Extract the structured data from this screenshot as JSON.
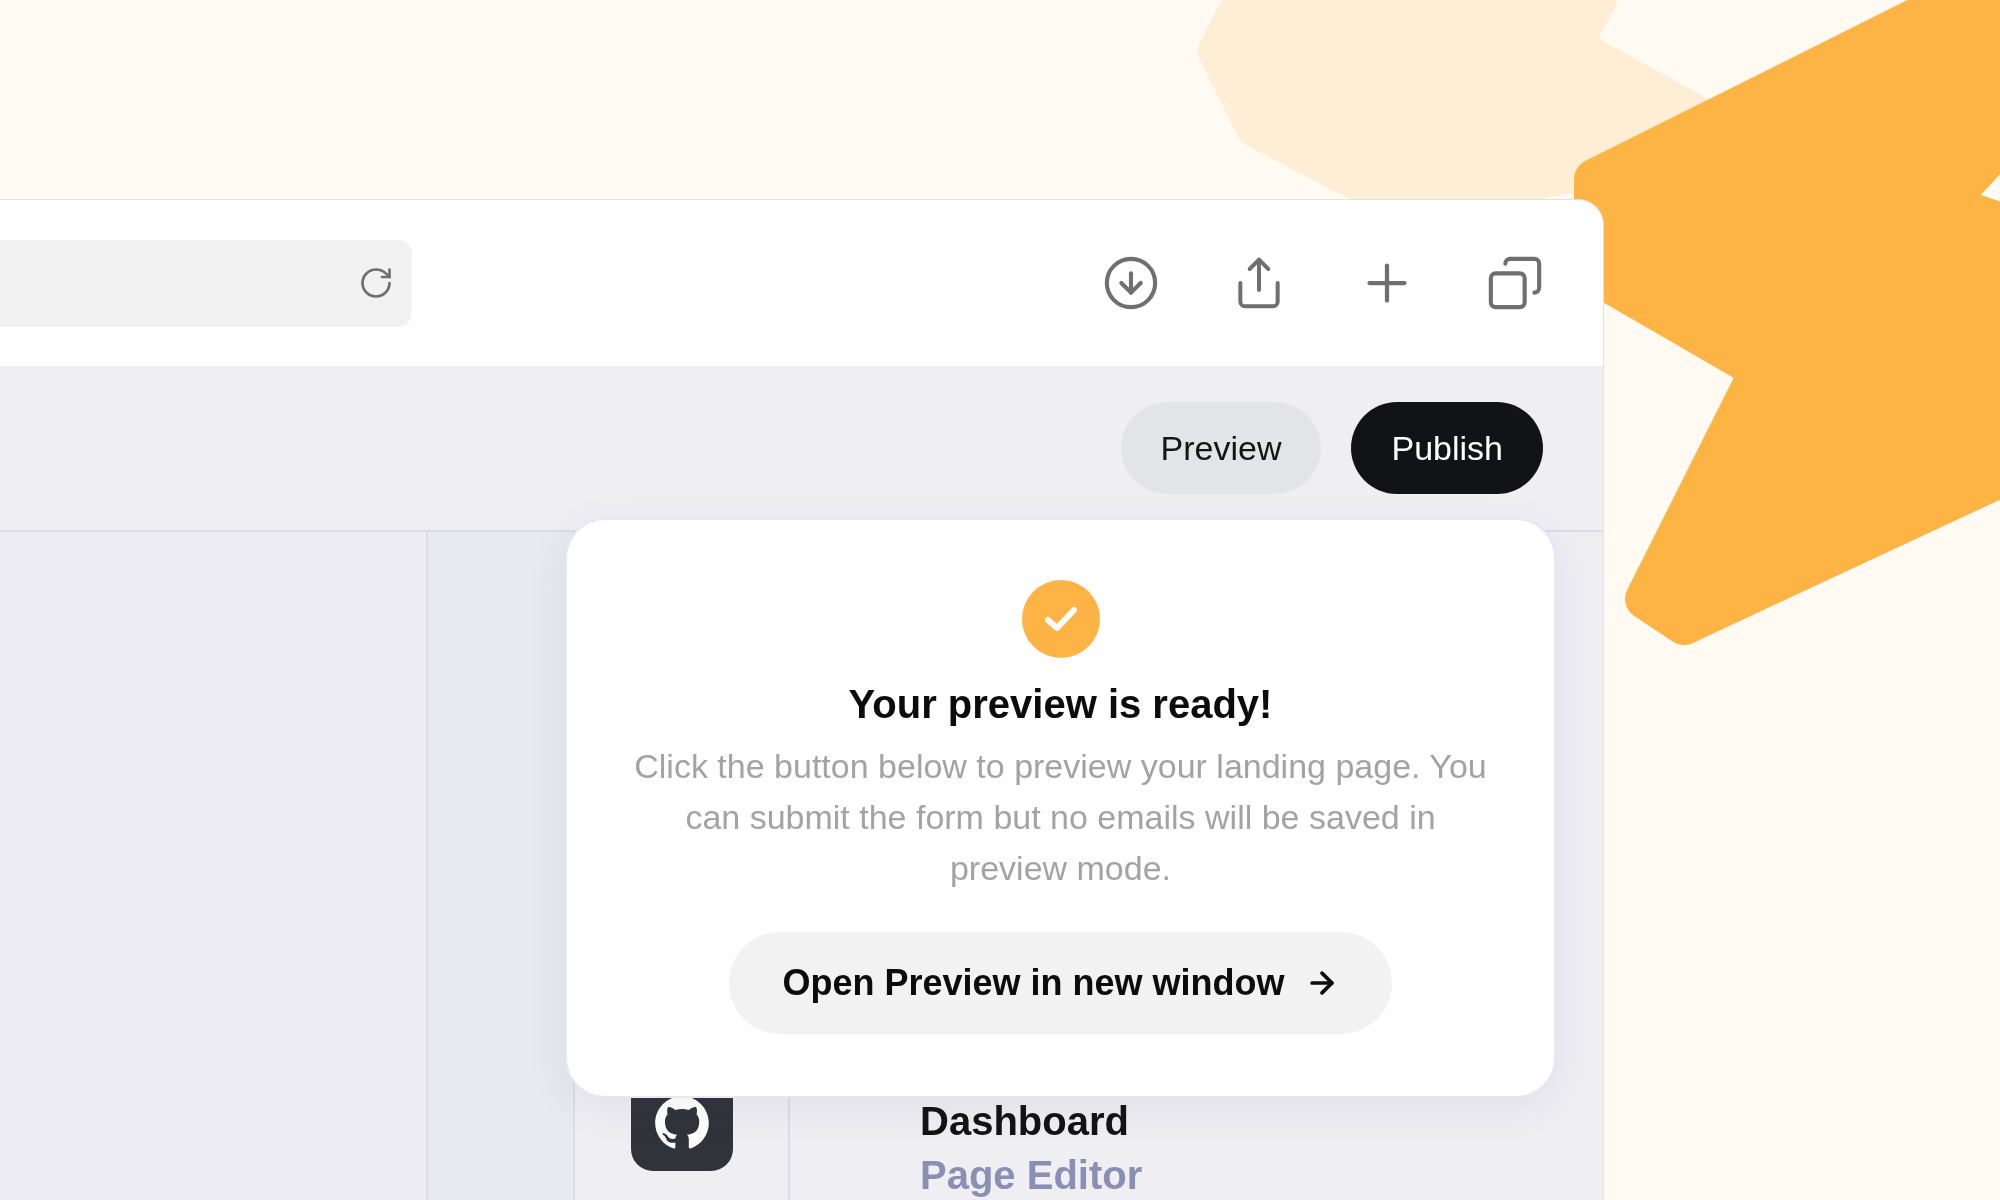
{
  "header": {
    "buttons": [
      {
        "label": "Preview",
        "kind": "secondary"
      },
      {
        "label": "Publish",
        "kind": "primary"
      }
    ]
  },
  "sidebar": {
    "items": [
      {
        "label": "Dashboard",
        "selected": true
      },
      {
        "label": "Page Editor",
        "selected": false
      }
    ]
  },
  "popup": {
    "title": "Your preview is ready!",
    "message": "Click the button below to preview your landing page. You can submit the form but no emails will be saved in preview mode.",
    "button": {
      "label": "Open Preview in new window"
    }
  }
}
